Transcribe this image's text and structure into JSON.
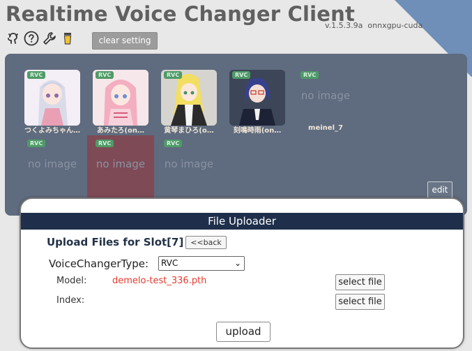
{
  "app": {
    "title": "Realtime Voice Changer Client",
    "version": "v.1.5.3.9a",
    "build": "onnxgpu-cuda"
  },
  "toolbar": {
    "icons": [
      "github-icon",
      "help-icon",
      "wrench-icon",
      "coffee-icon"
    ],
    "clear_setting_label": "clear setting"
  },
  "slots": {
    "badge": "RVC",
    "no_image": "no image",
    "items": [
      {
        "name": "つくよみちゃん…",
        "has_image": true
      },
      {
        "name": "あみたろ(on…",
        "has_image": true
      },
      {
        "name": "黄琴まひろ(o…",
        "has_image": true
      },
      {
        "name": "刻鳴時雨(on…",
        "has_image": true
      },
      {
        "name": "meinel_7",
        "has_image": false
      },
      {
        "name": "",
        "has_image": false
      },
      {
        "name": "",
        "has_image": false
      },
      {
        "name": "",
        "has_image": false
      }
    ],
    "edit_label": "edit"
  },
  "uploader": {
    "header": "File Uploader",
    "title": "Upload Files for Slot[7]",
    "back_label": "<<back",
    "voice_changer_type_label": "VoiceChangerType:",
    "voice_changer_type_value": "RVC",
    "model_label": "Model:",
    "model_value": "demelo-test_336.pth",
    "index_label": "Index:",
    "select_file_label": "select file",
    "upload_label": "upload"
  }
}
